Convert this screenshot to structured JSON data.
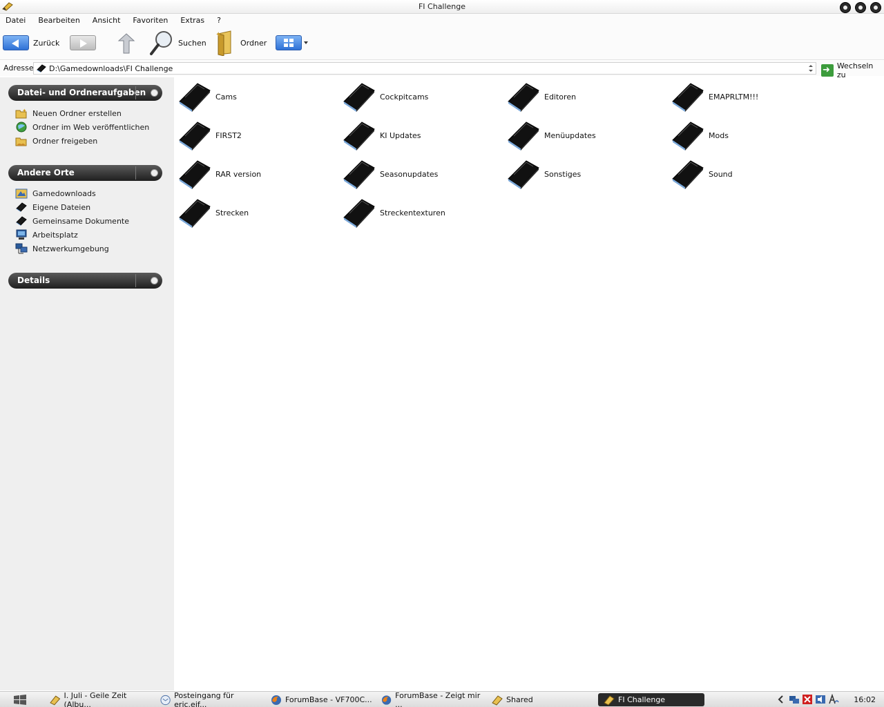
{
  "window": {
    "title": "FI Challenge"
  },
  "menu": [
    "Datei",
    "Bearbeiten",
    "Ansicht",
    "Favoriten",
    "Extras",
    "?"
  ],
  "toolbar": {
    "back_label": "Zurück",
    "search_label": "Suchen",
    "folders_label": "Ordner"
  },
  "address": {
    "label": "Adresse",
    "path": "D:\\Gamedownloads\\FI Challenge",
    "go_label": "Wechseln zu"
  },
  "sidebar": {
    "tasks": {
      "title": "Datei- und Ordneraufgaben",
      "items": [
        {
          "label": "Neuen Ordner erstellen",
          "icon": "new-folder-icon"
        },
        {
          "label": "Ordner im Web veröffentlichen",
          "icon": "web-publish-icon"
        },
        {
          "label": "Ordner freigeben",
          "icon": "share-folder-icon"
        }
      ]
    },
    "places": {
      "title": "Andere Orte",
      "items": [
        {
          "label": "Gamedownloads",
          "icon": "folder-icon"
        },
        {
          "label": "Eigene Dateien",
          "icon": "my-documents-icon"
        },
        {
          "label": "Gemeinsame Dokumente",
          "icon": "shared-documents-icon"
        },
        {
          "label": "Arbeitsplatz",
          "icon": "my-computer-icon"
        },
        {
          "label": "Netzwerkumgebung",
          "icon": "network-icon"
        }
      ]
    },
    "details": {
      "title": "Details"
    }
  },
  "folders": [
    "Cams",
    "Cockpitcams",
    "Editoren",
    "EMAPRLTM!!!",
    "FIRST2",
    "KI Updates",
    "Menüupdates",
    "Mods",
    "RAR version",
    "Seasonupdates",
    "Sonstiges",
    "Sound",
    "Strecken",
    "Streckentexturen"
  ],
  "taskbar": {
    "items": [
      {
        "label": "I. Juli  - Geile Zeit (Albu...",
        "icon": "media-player-icon"
      },
      {
        "label": "Posteingang für eric.eif...",
        "icon": "mail-icon"
      },
      {
        "label": "ForumBase - VF700C...",
        "icon": "firefox-icon"
      },
      {
        "label": "ForumBase - Zeigt mir ...",
        "icon": "firefox-icon"
      },
      {
        "label": "Shared",
        "icon": "folder-icon"
      },
      {
        "label": "FI Challenge",
        "icon": "folder-icon",
        "active": true
      }
    ],
    "clock": "16:02"
  }
}
